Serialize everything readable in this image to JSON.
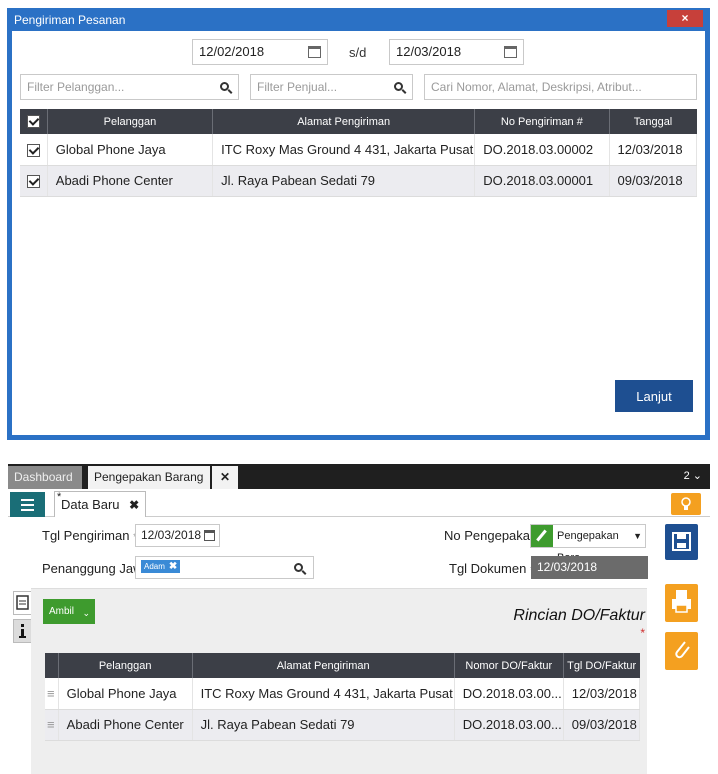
{
  "dialog": {
    "title": "Pengiriman Pesanan",
    "close_label": "×",
    "date_from": "12/02/2018",
    "date_separator": "s/d",
    "date_to": "12/03/2018",
    "filter_customer_placeholder": "Filter Pelanggan...",
    "filter_seller_placeholder": "Filter Penjual...",
    "search_placeholder": "Cari Nomor, Alamat, Deskripsi, Atribut...",
    "columns": [
      "Pelanggan",
      "Alamat Pengiriman",
      "No Pengiriman #",
      "Tanggal"
    ],
    "rows": [
      {
        "customer": "Global Phone Jaya",
        "address": "ITC Roxy Mas Ground 4 431, Jakarta Pusat",
        "number": "DO.2018.03.00002",
        "date": "12/03/2018"
      },
      {
        "customer": "Abadi Phone Center",
        "address": "Jl. Raya Pabean Sedati 79",
        "number": "DO.2018.03.00001",
        "date": "09/03/2018"
      }
    ],
    "next_button": "Lanjut"
  },
  "app": {
    "tabs": {
      "dashboard": "Dashboard",
      "packing": "Pengepakan Barang",
      "close": "✕"
    },
    "tab_count": "2",
    "doc_tab": {
      "label": "Data Baru",
      "close": "✖",
      "modified_mark": "*"
    },
    "form": {
      "ship_date_label": "Tgl Pengiriman",
      "ship_date_value": "12/03/2018",
      "pic_label": "Penanggung Jawa",
      "pic_chip": "Adam",
      "pack_no_label": "No Pengepakan",
      "pack_no_value": "Pengepakan Bara",
      "doc_date_label": "Tgl Dokumen",
      "doc_date_value": "12/03/2018",
      "required_mark": "*"
    },
    "panel": {
      "take_button": "Ambil",
      "title": "Rincian DO/Faktur",
      "required_mark": "*",
      "columns": [
        "Pelanggan",
        "Alamat Pengiriman",
        "Nomor DO/Faktur",
        "Tgl DO/Faktur"
      ],
      "rows": [
        {
          "customer": "Global Phone Jaya",
          "address": "ITC Roxy Mas Ground 4 431, Jakarta Pusat",
          "number": "DO.2018.03.00...",
          "date": "12/03/2018"
        },
        {
          "customer": "Abadi Phone Center",
          "address": "Jl. Raya Pabean Sedati 79",
          "number": "DO.2018.03.00...",
          "date": "09/03/2018"
        }
      ]
    },
    "colors": {
      "save": "#1e4f91",
      "orange": "#f4a020",
      "green": "#3e9b2e",
      "teal": "#1a6e77"
    }
  }
}
